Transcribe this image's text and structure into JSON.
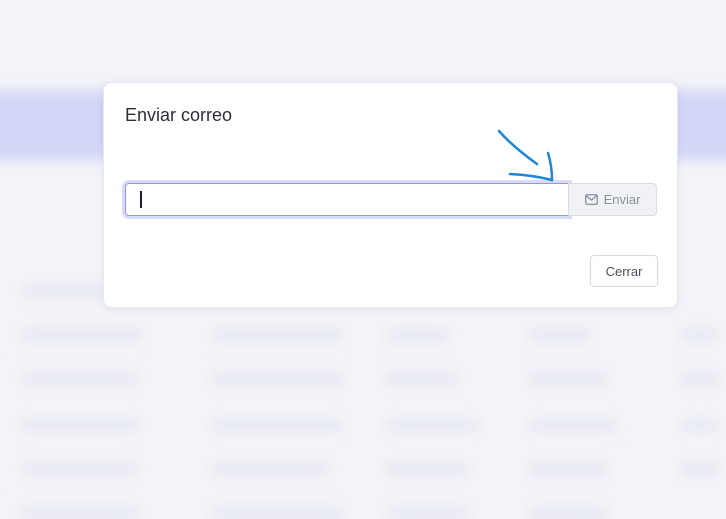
{
  "modal": {
    "title": "Enviar correo",
    "email_input": {
      "value": "",
      "placeholder": ""
    },
    "send_button": {
      "label": "Enviar",
      "icon": "envelope-icon"
    },
    "close_button": {
      "label": "Cerrar"
    }
  },
  "colors": {
    "accent": "#8e96ef",
    "annotation": "#1e86d6",
    "backdrop": "#f3f4f9"
  }
}
